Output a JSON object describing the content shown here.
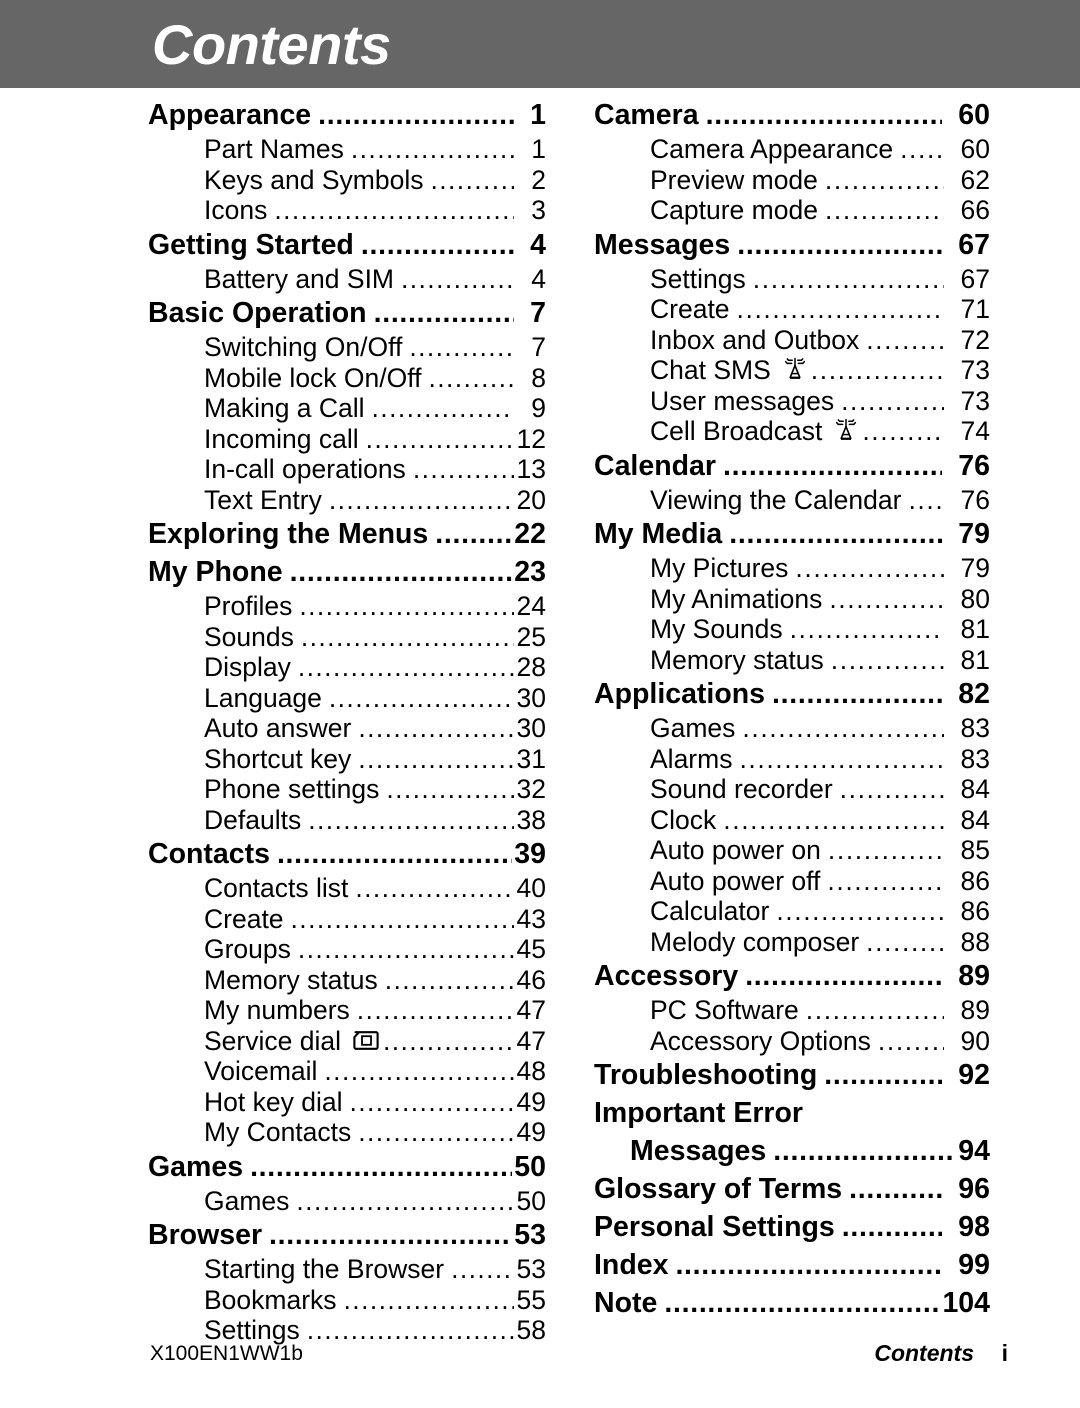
{
  "header": {
    "title": "Contents",
    "bar_color": "#666666",
    "title_color": "#ffffff"
  },
  "footer": {
    "document_code": "X100EN1WW1b",
    "section_label": "Contents",
    "page_number": "i"
  },
  "toc": {
    "left_column": [
      {
        "type": "section",
        "label": "Appearance",
        "page": "1"
      },
      {
        "type": "item",
        "label": "Part Names",
        "page": "1"
      },
      {
        "type": "item",
        "label": "Keys and Symbols",
        "page": "2"
      },
      {
        "type": "item",
        "label": "Icons",
        "page": "3"
      },
      {
        "type": "section",
        "label": "Getting Started",
        "page": "4"
      },
      {
        "type": "item",
        "label": "Battery and SIM",
        "page": "4"
      },
      {
        "type": "section",
        "label": "Basic Operation",
        "page": "7"
      },
      {
        "type": "item",
        "label": "Switching On/Off",
        "page": "7"
      },
      {
        "type": "item",
        "label": "Mobile lock On/Off",
        "page": "8"
      },
      {
        "type": "item",
        "label": "Making a Call",
        "page": "9"
      },
      {
        "type": "item",
        "label": "Incoming call",
        "page": "12"
      },
      {
        "type": "item",
        "label": "In-call operations",
        "page": "13"
      },
      {
        "type": "item",
        "label": "Text Entry",
        "page": "20"
      },
      {
        "type": "section",
        "label": "Exploring the Menus",
        "page": "22"
      },
      {
        "type": "section",
        "label": "My Phone",
        "page": "23"
      },
      {
        "type": "item",
        "label": "Profiles",
        "page": "24"
      },
      {
        "type": "item",
        "label": "Sounds",
        "page": "25"
      },
      {
        "type": "item",
        "label": "Display",
        "page": "28"
      },
      {
        "type": "item",
        "label": "Language",
        "page": "30"
      },
      {
        "type": "item",
        "label": "Auto answer",
        "page": "30"
      },
      {
        "type": "item",
        "label": "Shortcut key",
        "page": "31"
      },
      {
        "type": "item",
        "label": "Phone settings",
        "page": "32"
      },
      {
        "type": "item",
        "label": "Defaults",
        "page": "38"
      },
      {
        "type": "section",
        "label": "Contacts",
        "page": "39"
      },
      {
        "type": "item",
        "label": "Contacts list",
        "page": "40"
      },
      {
        "type": "item",
        "label": "Create",
        "page": "43"
      },
      {
        "type": "item",
        "label": "Groups",
        "page": "45"
      },
      {
        "type": "item",
        "label": "Memory status",
        "page": "46"
      },
      {
        "type": "item",
        "label": "My numbers",
        "page": "47"
      },
      {
        "type": "item",
        "label": "Service dial",
        "page": "47",
        "icon": "sim-card-icon"
      },
      {
        "type": "item",
        "label": "Voicemail",
        "page": "48"
      },
      {
        "type": "item",
        "label": "Hot key dial",
        "page": "49"
      },
      {
        "type": "item",
        "label": "My Contacts",
        "page": "49"
      },
      {
        "type": "section",
        "label": "Games",
        "page": "50"
      },
      {
        "type": "item",
        "label": "Games",
        "page": "50"
      },
      {
        "type": "section",
        "label": "Browser",
        "page": "53"
      },
      {
        "type": "item",
        "label": "Starting the Browser",
        "page": "53"
      },
      {
        "type": "item",
        "label": "Bookmarks",
        "page": "55"
      },
      {
        "type": "item",
        "label": "Settings",
        "page": "58"
      }
    ],
    "right_column": [
      {
        "type": "section",
        "label": "Camera",
        "page": "60"
      },
      {
        "type": "item",
        "label": "Camera Appearance",
        "page": "60"
      },
      {
        "type": "item",
        "label": "Preview mode",
        "page": "62"
      },
      {
        "type": "item",
        "label": "Capture mode",
        "page": "66"
      },
      {
        "type": "section",
        "label": "Messages",
        "page": "67"
      },
      {
        "type": "item",
        "label": "Settings",
        "page": "67"
      },
      {
        "type": "item",
        "label": "Create",
        "page": "71"
      },
      {
        "type": "item",
        "label": "Inbox and Outbox",
        "page": "72"
      },
      {
        "type": "item",
        "label": "Chat SMS",
        "page": "73",
        "icon": "antenna-tower-icon"
      },
      {
        "type": "item",
        "label": "User messages",
        "page": "73"
      },
      {
        "type": "item",
        "label": "Cell Broadcast",
        "page": "74",
        "icon": "antenna-tower-icon"
      },
      {
        "type": "section",
        "label": "Calendar",
        "page": "76"
      },
      {
        "type": "item",
        "label": "Viewing the Calendar",
        "page": "76"
      },
      {
        "type": "section",
        "label": "My Media",
        "page": "79"
      },
      {
        "type": "item",
        "label": "My Pictures",
        "page": "79"
      },
      {
        "type": "item",
        "label": "My Animations",
        "page": "80"
      },
      {
        "type": "item",
        "label": "My Sounds",
        "page": "81"
      },
      {
        "type": "item",
        "label": "Memory status",
        "page": "81"
      },
      {
        "type": "section",
        "label": "Applications",
        "page": "82"
      },
      {
        "type": "item",
        "label": "Games",
        "page": "83"
      },
      {
        "type": "item",
        "label": "Alarms",
        "page": "83"
      },
      {
        "type": "item",
        "label": "Sound recorder",
        "page": "84"
      },
      {
        "type": "item",
        "label": "Clock",
        "page": "84"
      },
      {
        "type": "item",
        "label": "Auto power on",
        "page": "85"
      },
      {
        "type": "item",
        "label": "Auto power off",
        "page": "86"
      },
      {
        "type": "item",
        "label": "Calculator",
        "page": "86"
      },
      {
        "type": "item",
        "label": "Melody composer",
        "page": "88"
      },
      {
        "type": "section",
        "label": "Accessory",
        "page": "89"
      },
      {
        "type": "item",
        "label": "PC Software",
        "page": "89"
      },
      {
        "type": "item",
        "label": "Accessory Options",
        "page": "90"
      },
      {
        "type": "section",
        "label": "Troubleshooting",
        "page": "92"
      },
      {
        "type": "section-nodots",
        "label": "Important Error",
        "page": ""
      },
      {
        "type": "continuation",
        "label": "Messages",
        "page": "94"
      },
      {
        "type": "section",
        "label": "Glossary of Terms",
        "page": "96"
      },
      {
        "type": "section",
        "label": "Personal Settings",
        "page": "98"
      },
      {
        "type": "section",
        "label": "Index",
        "page": "99"
      },
      {
        "type": "section",
        "label": "Note",
        "page": "104"
      }
    ]
  }
}
